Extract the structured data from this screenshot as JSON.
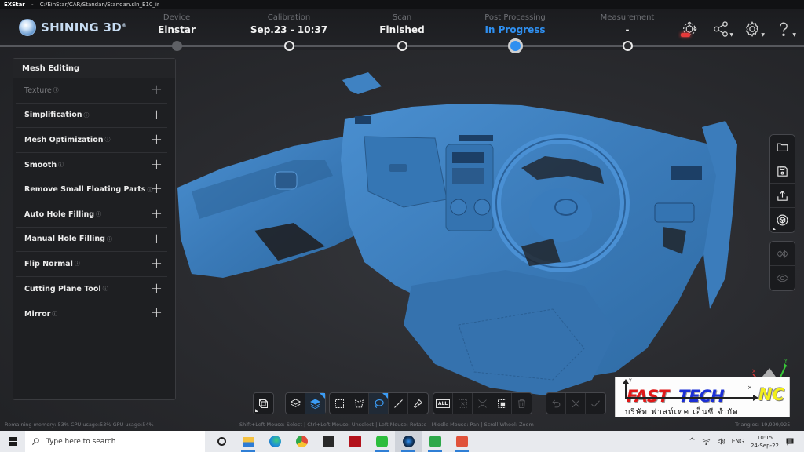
{
  "window": {
    "app_name": "EXStar",
    "separator": "-",
    "file_path": "C:/EinStar/CAR/Standan/Standan.sln_E10_ir"
  },
  "header": {
    "logo_text": "SHINING 3D",
    "logo_mark": "®",
    "steps": [
      {
        "label": "Device",
        "value": "Einstar",
        "state": "done"
      },
      {
        "label": "Calibration",
        "value": "Sep.23 - 10:37",
        "state": "done"
      },
      {
        "label": "Scan",
        "value": "Finished",
        "state": "done"
      },
      {
        "label": "Post Processing",
        "value": "In Progress",
        "state": "active"
      },
      {
        "label": "Measurement",
        "value": "-",
        "state": "pending"
      }
    ],
    "icons": [
      {
        "name": "record-icon",
        "has_caret": false
      },
      {
        "name": "share-icon",
        "has_caret": true
      },
      {
        "name": "settings-gear-icon",
        "has_caret": true
      },
      {
        "name": "help-icon",
        "has_caret": true
      }
    ],
    "accent_color": "#2f8ff0"
  },
  "panel": {
    "title": "Mesh Editing",
    "items": [
      {
        "label": "Texture",
        "disabled": true
      },
      {
        "label": "Simplification",
        "disabled": false
      },
      {
        "label": "Mesh Optimization",
        "disabled": false
      },
      {
        "label": "Smooth",
        "disabled": false
      },
      {
        "label": "Remove Small Floating Parts",
        "disabled": false
      },
      {
        "label": "Auto Hole Filling",
        "disabled": false
      },
      {
        "label": "Manual Hole Filling",
        "disabled": false
      },
      {
        "label": "Flip Normal",
        "disabled": false
      },
      {
        "label": "Cutting Plane Tool",
        "disabled": false
      },
      {
        "label": "Mirror",
        "disabled": false
      }
    ],
    "info_glyph": "ⓘ",
    "expand_glyph": "+"
  },
  "right_toolbar": {
    "group1": [
      "open-folder-icon",
      "save-icon",
      "export-icon",
      "view-cube-icon"
    ],
    "group2": [
      "mesh-display-icon",
      "visibility-eye-icon"
    ]
  },
  "bottom_toolbar": {
    "view": [
      "view-orientation-icon"
    ],
    "selection_mode": [
      "select-visible-layer-icon",
      "select-through-layer-icon"
    ],
    "selection_tools": [
      "rectangle-select-icon",
      "polygon-select-icon",
      "lasso-select-icon",
      "line-select-icon",
      "brush-select-icon"
    ],
    "selection_ops": [
      "select-all-icon",
      "deselect-icon",
      "invert-select-icon",
      "select-connected-icon",
      "delete-icon"
    ],
    "history": [
      "undo-icon",
      "cancel-icon",
      "apply-icon"
    ],
    "select_all_label": "ALL"
  },
  "status": {
    "system": "Remaining memory: 53% CPU usage:53%  GPU usage:54%",
    "hint": "Shift+Left Mouse: Select | Ctrl+Left Mouse: Unselect | Left Mouse: Rotate | Middle Mouse: Pan | Scroll Wheel: Zoom",
    "triangles": "Triangles: 19,999,925"
  },
  "axis_gizmo": {
    "x_label": "X",
    "y_label": "Y"
  },
  "watermark": {
    "word1": "FAST",
    "word2": "TECH",
    "word3": "NC",
    "thai": "บริษัท ฟาสท์เทค เอ็นซี จำกัด",
    "y_axis": "Y",
    "x_axis": "×"
  },
  "taskbar": {
    "search_placeholder": "Type here to search",
    "apps": [
      {
        "name": "cortana-icon",
        "color": "#222222",
        "open": false
      },
      {
        "name": "file-explorer-icon",
        "color": "#f5c242",
        "open": true
      },
      {
        "name": "edge-icon",
        "color": "#1e8fd8",
        "open": false
      },
      {
        "name": "chrome-icon",
        "color": "#e04a3a",
        "open": false
      },
      {
        "name": "store-icon",
        "color": "#2a2a2a",
        "open": false
      },
      {
        "name": "app-red-icon",
        "color": "#b3121b",
        "open": false
      },
      {
        "name": "line-icon",
        "color": "#2cbd3c",
        "open": true
      },
      {
        "name": "exstar-icon",
        "color": "#0f2a4a",
        "open": true
      },
      {
        "name": "camtasia-green-icon",
        "color": "#2ea84a",
        "open": true
      },
      {
        "name": "camtasia-red-icon",
        "color": "#e0523a",
        "open": true
      }
    ],
    "tray": {
      "language": "ENG",
      "time": "10:15",
      "date": "24-Sep-22"
    }
  },
  "mesh_color": "#3d7fbf"
}
